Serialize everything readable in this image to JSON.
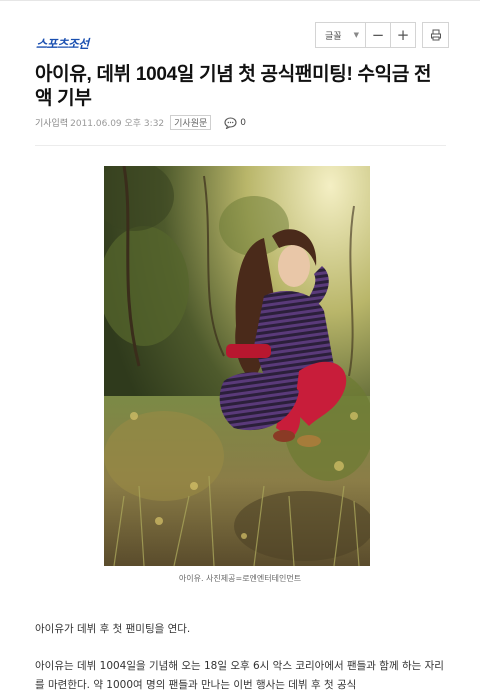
{
  "header": {
    "brand": "스포츠조선"
  },
  "toolbar": {
    "font_label": "글꼴",
    "font_caret": "▼",
    "decrease_label": "−",
    "increase_label": "+"
  },
  "article": {
    "title": "아이유, 데뷔 1004일 기념 첫 공식팬미팅! 수익금 전액 기부",
    "meta_label": "기사입력",
    "date": "2011.06.09 오후 3:32",
    "source_button": "기사원문",
    "comment_count": "0",
    "photo_caption": "아이유. 사진제공=로엔엔터테인먼트",
    "paragraphs": [
      "아이유가 데뷔 후 첫 팬미팅을 연다.",
      "아이유는 데뷔 1004일을 기념해 오는 18일 오후 6시 악스 코리아에서 팬들과 함께 하는 자리를 마련한다. 약 1000여 명의 팬들과 만나는 이번 행사는 데뷔 후 첫 공식"
    ]
  },
  "colors": {
    "brand": "#1a4fb0",
    "title": "#111111",
    "meta": "#888888",
    "body": "#333333"
  }
}
